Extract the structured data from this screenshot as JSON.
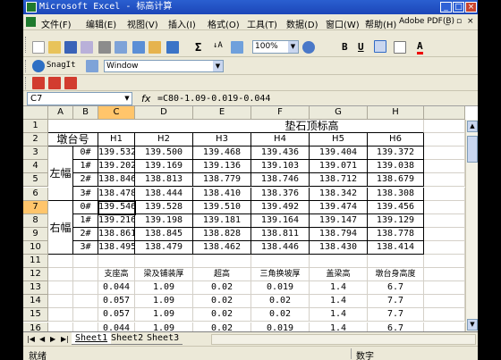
{
  "window": {
    "title": "Microsoft Excel - 标高计算"
  },
  "menu": {
    "items": [
      "文件(F)",
      "编辑(E)",
      "视图(V)",
      "插入(I)",
      "格式(O)",
      "工具(T)",
      "数据(D)",
      "窗口(W)",
      "帮助(H)",
      "Adobe PDF(B)"
    ]
  },
  "toolbar": {
    "zoom": "100%",
    "snagit": "SnagIt",
    "window_label": "Window"
  },
  "formula_bar": {
    "cell_ref": "C7",
    "fx": "fx",
    "formula": "=C80-1.09-0.019-0.044"
  },
  "columns": [
    "A",
    "B",
    "C",
    "D",
    "E",
    "F",
    "G",
    "H"
  ],
  "rows": [
    "1",
    "2",
    "3",
    "4",
    "5",
    "6",
    "7",
    "8",
    "9",
    "10",
    "11",
    "12",
    "13",
    "14",
    "15",
    "16"
  ],
  "sheet": {
    "title": "垫石顶标高",
    "group_header": "墩台号",
    "left_group": "左幅",
    "right_group": "右幅",
    "headers": [
      "H1",
      "H2",
      "H3",
      "H4",
      "H5",
      "H6"
    ],
    "data_rows": [
      {
        "num": "0#",
        "values": [
          "139.532",
          "139.500",
          "139.468",
          "139.436",
          "139.404",
          "139.372"
        ]
      },
      {
        "num": "1#",
        "values": [
          "139.202",
          "139.169",
          "139.136",
          "139.103",
          "139.071",
          "139.038"
        ]
      },
      {
        "num": "2#",
        "values": [
          "138.846",
          "138.813",
          "138.779",
          "138.746",
          "138.712",
          "138.679"
        ]
      },
      {
        "num": "3#",
        "values": [
          "138.478",
          "138.444",
          "138.410",
          "138.376",
          "138.342",
          "138.308"
        ]
      },
      {
        "num": "0#",
        "values": [
          "139.546",
          "139.528",
          "139.510",
          "139.492",
          "139.474",
          "139.456"
        ]
      },
      {
        "num": "1#",
        "values": [
          "139.216",
          "139.198",
          "139.181",
          "139.164",
          "139.147",
          "139.129"
        ]
      },
      {
        "num": "2#",
        "values": [
          "138.861",
          "138.845",
          "138.828",
          "138.811",
          "138.794",
          "138.778"
        ]
      },
      {
        "num": "3#",
        "values": [
          "138.495",
          "138.479",
          "138.462",
          "138.446",
          "138.430",
          "138.414"
        ]
      }
    ],
    "bottom_headers": [
      "支座高",
      "梁及铺装厚",
      "超高",
      "三角换坡厚",
      "盖梁高",
      "墩台身高度"
    ],
    "bottom_rows": [
      [
        "0.044",
        "1.09",
        "0.02",
        "0.019",
        "1.4",
        "6.7"
      ],
      [
        "0.057",
        "1.09",
        "0.02",
        "0.02",
        "1.4",
        "7.7"
      ],
      [
        "0.057",
        "1.09",
        "0.02",
        "0.02",
        "1.4",
        "7.7"
      ],
      [
        "0.044",
        "1.09",
        "0.02",
        "0.019",
        "1.4",
        "6.7"
      ]
    ]
  },
  "tabs": [
    "Sheet1",
    "Sheet2",
    "Sheet3"
  ],
  "status": {
    "left": "就绪",
    "mode": "数字"
  }
}
